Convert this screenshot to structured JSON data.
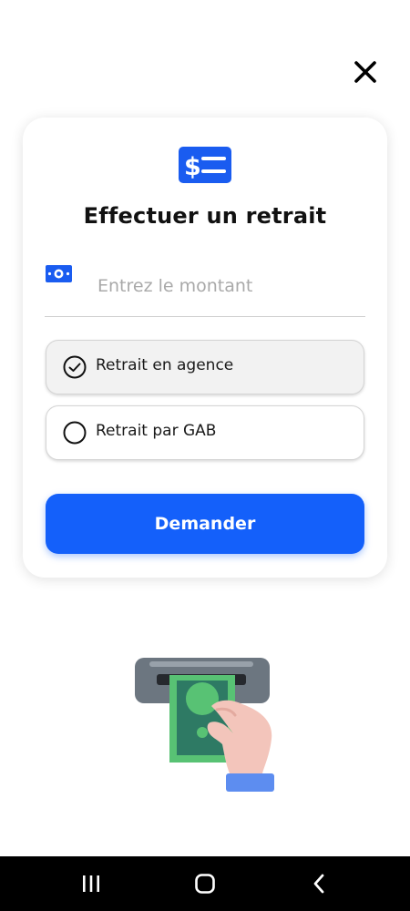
{
  "header": {
    "close_icon": "close-icon"
  },
  "card": {
    "icon": "dollar-document-icon",
    "title": "Effectuer un retrait",
    "amount": {
      "icon": "banknote-icon",
      "value": "",
      "placeholder": "Entrez le montant"
    },
    "options": [
      {
        "label": "Retrait en agence",
        "selected": true
      },
      {
        "label": "Retrait par GAB",
        "selected": false
      }
    ],
    "submit_label": "Demander"
  },
  "illustration": {
    "icon": "atm-cash-withdrawal-illustration"
  },
  "navbar": {
    "recent_icon": "recent-apps-icon",
    "home_icon": "home-icon",
    "back_icon": "back-chevron-icon"
  },
  "colors": {
    "primary": "#1460fa",
    "icon_blue": "#1a5cf0",
    "text_dark": "#111111",
    "placeholder": "#a9a9a9",
    "selected_bg": "#f2f2f2",
    "navbar_bg": "#000000"
  }
}
